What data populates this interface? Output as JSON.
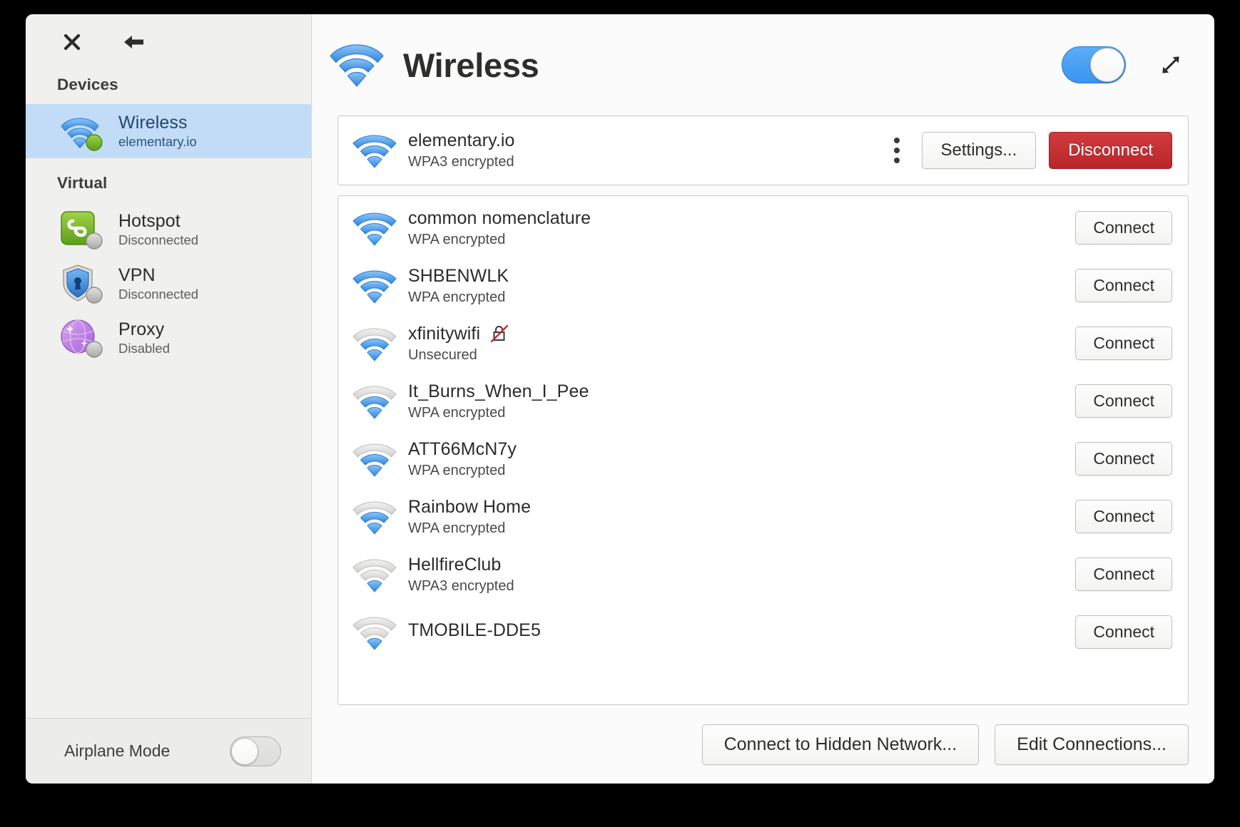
{
  "window": {
    "toolbar": {
      "close_icon": "close-icon",
      "back_icon": "back-arrow-icon"
    }
  },
  "sidebar": {
    "sections": [
      {
        "label": "Devices"
      },
      {
        "label": "Virtual"
      }
    ],
    "devices": [
      {
        "name": "Wireless",
        "status": "elementary.io",
        "icon": "wifi-icon",
        "badge": "connected-green",
        "selected": true
      }
    ],
    "virtual": [
      {
        "name": "Hotspot",
        "status": "Disconnected",
        "icon": "hotspot-icon",
        "badge": "offline-grey"
      },
      {
        "name": "VPN",
        "status": "Disconnected",
        "icon": "vpn-shield-icon",
        "badge": "offline-grey"
      },
      {
        "name": "Proxy",
        "status": "Disabled",
        "icon": "proxy-globe-icon",
        "badge": "offline-grey"
      }
    ],
    "airplane": {
      "label": "Airplane Mode",
      "enabled": false
    }
  },
  "header": {
    "title": "Wireless",
    "icon": "wifi-icon",
    "wifi_enabled": true,
    "expand_icon": "expand-diagonal-icon"
  },
  "connected": {
    "name": "elementary.io",
    "security": "WPA3 encrypted",
    "signal": 3,
    "menu_icon": "kebab-menu-icon",
    "settings_label": "Settings...",
    "disconnect_label": "Disconnect"
  },
  "available": {
    "connect_label": "Connect",
    "networks": [
      {
        "name": "common nomenclature",
        "security": "WPA encrypted",
        "signal": 4,
        "unsecured": false
      },
      {
        "name": "SHBENWLK",
        "security": "WPA encrypted",
        "signal": 4,
        "unsecured": false
      },
      {
        "name": "xfinitywifi",
        "security": "Unsecured",
        "signal": 2,
        "unsecured": true
      },
      {
        "name": "It_Burns_When_I_Pee",
        "security": "WPA encrypted",
        "signal": 2,
        "unsecured": false
      },
      {
        "name": "ATT66McN7y",
        "security": "WPA encrypted",
        "signal": 2,
        "unsecured": false
      },
      {
        "name": "Rainbow Home",
        "security": "WPA encrypted",
        "signal": 2,
        "unsecured": false
      },
      {
        "name": "HellfireClub",
        "security": "WPA3 encrypted",
        "signal": 1,
        "unsecured": false
      },
      {
        "name": "TMOBILE-DDE5",
        "security": "",
        "signal": 1,
        "unsecured": false
      }
    ]
  },
  "footer": {
    "hidden_network_label": "Connect to Hidden Network...",
    "edit_connections_label": "Edit Connections..."
  },
  "colors": {
    "accent": "#3a95f0",
    "selection": "#c2dcf7",
    "danger": "#b92529",
    "wifi_blue": "#3d96e8",
    "wifi_grey": "#d4d4d2"
  }
}
